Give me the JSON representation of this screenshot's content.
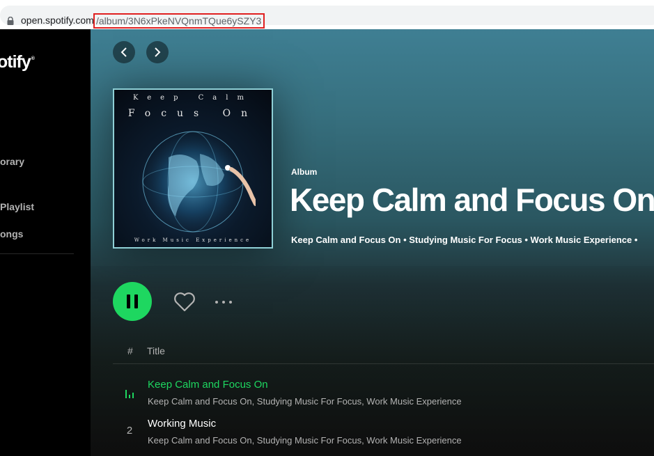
{
  "browser": {
    "url_domain": "open.spotify.com",
    "url_path": "/album/3N6xPkeNVQnmTQue6ySZY3"
  },
  "sidebar": {
    "brand": "otify",
    "items": [
      {
        "label": "orary"
      },
      {
        "label": "Playlist"
      },
      {
        "label": "ongs"
      }
    ]
  },
  "album": {
    "type": "Album",
    "title": "Keep Calm and Focus On",
    "artists": "Keep Calm and Focus On • Studying Music For Focus • Work Music Experience •",
    "cover": {
      "line1": "Keep Calm",
      "line2": "Focus On",
      "bottom": "Work Music Experience"
    }
  },
  "tracklist": {
    "header_num": "#",
    "header_title": "Title",
    "tracks": [
      {
        "num": "",
        "title": "Keep Calm and Focus On",
        "artists": "Keep Calm and Focus On, Studying Music For Focus, Work Music Experience",
        "playing": true
      },
      {
        "num": "2",
        "title": "Working Music",
        "artists": "Keep Calm and Focus On, Studying Music For Focus, Work Music Experience",
        "playing": false
      }
    ]
  },
  "colors": {
    "accent": "#1ed760",
    "header_gradient_top": "#3f7f93",
    "background": "#121212",
    "highlight_box": "#e02020"
  },
  "icons": {
    "nav_back": "chevron-left-icon",
    "nav_forward": "chevron-right-icon",
    "play_state": "pause-icon",
    "like": "heart-icon",
    "more": "more-options-icon",
    "now_playing": "equalizer-icon"
  }
}
